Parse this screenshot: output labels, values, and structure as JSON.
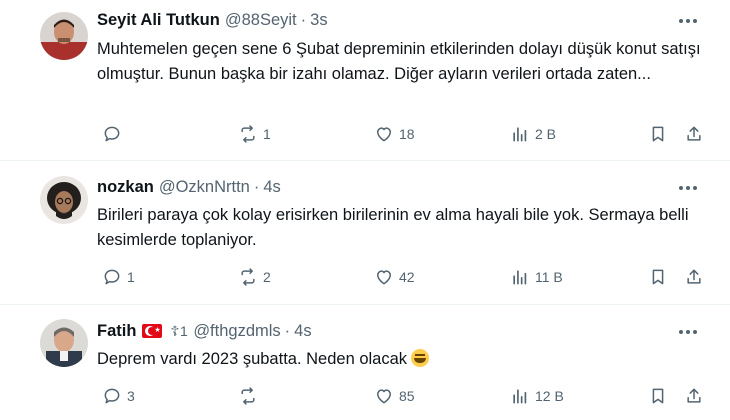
{
  "tweets": [
    {
      "name": "Seyit Ali Tutkun",
      "handle": "@88Seyit",
      "time": "3s",
      "text": "Muhtemelen geçen sene 6 Şubat depreminin etkilerinden dolayı düşük konut satışı olmuştur.  Bunun başka bir izahı olamaz. Diğer ayların verileri ortada zaten...",
      "replies": "",
      "reposts": "1",
      "likes": "18",
      "views": "2 B",
      "avatar_color": "#7a4a3a"
    },
    {
      "name": "nozkan",
      "handle": "@OzknNrttn",
      "time": "4s",
      "text": "Birileri paraya çok kolay erisirken birilerinin ev alma hayali bile yok. Sermaya belli kesimlerde toplaniyor.",
      "replies": "1",
      "reposts": "2",
      "likes": "42",
      "views": "11 B",
      "avatar_color": "#3a3633"
    },
    {
      "name": "Fatih",
      "badge": "☦1",
      "handle": "@fthgzdmls",
      "time": "4s",
      "text": "Deprem vardı 2023 şubatta. Neden olacak",
      "replies": "3",
      "reposts": "",
      "likes": "85",
      "views": "12 B",
      "avatar_color": "#8f8a85"
    }
  ],
  "icons": {
    "reply": "reply-icon",
    "repost": "repost-icon",
    "like": "heart-icon",
    "views": "views-icon",
    "bookmark": "bookmark-icon",
    "share": "share-icon",
    "more": "more-icon"
  },
  "colors": {
    "text": "#0f1419",
    "muted": "#536471",
    "divider": "#eff3f4",
    "flag": "#e30a17"
  }
}
